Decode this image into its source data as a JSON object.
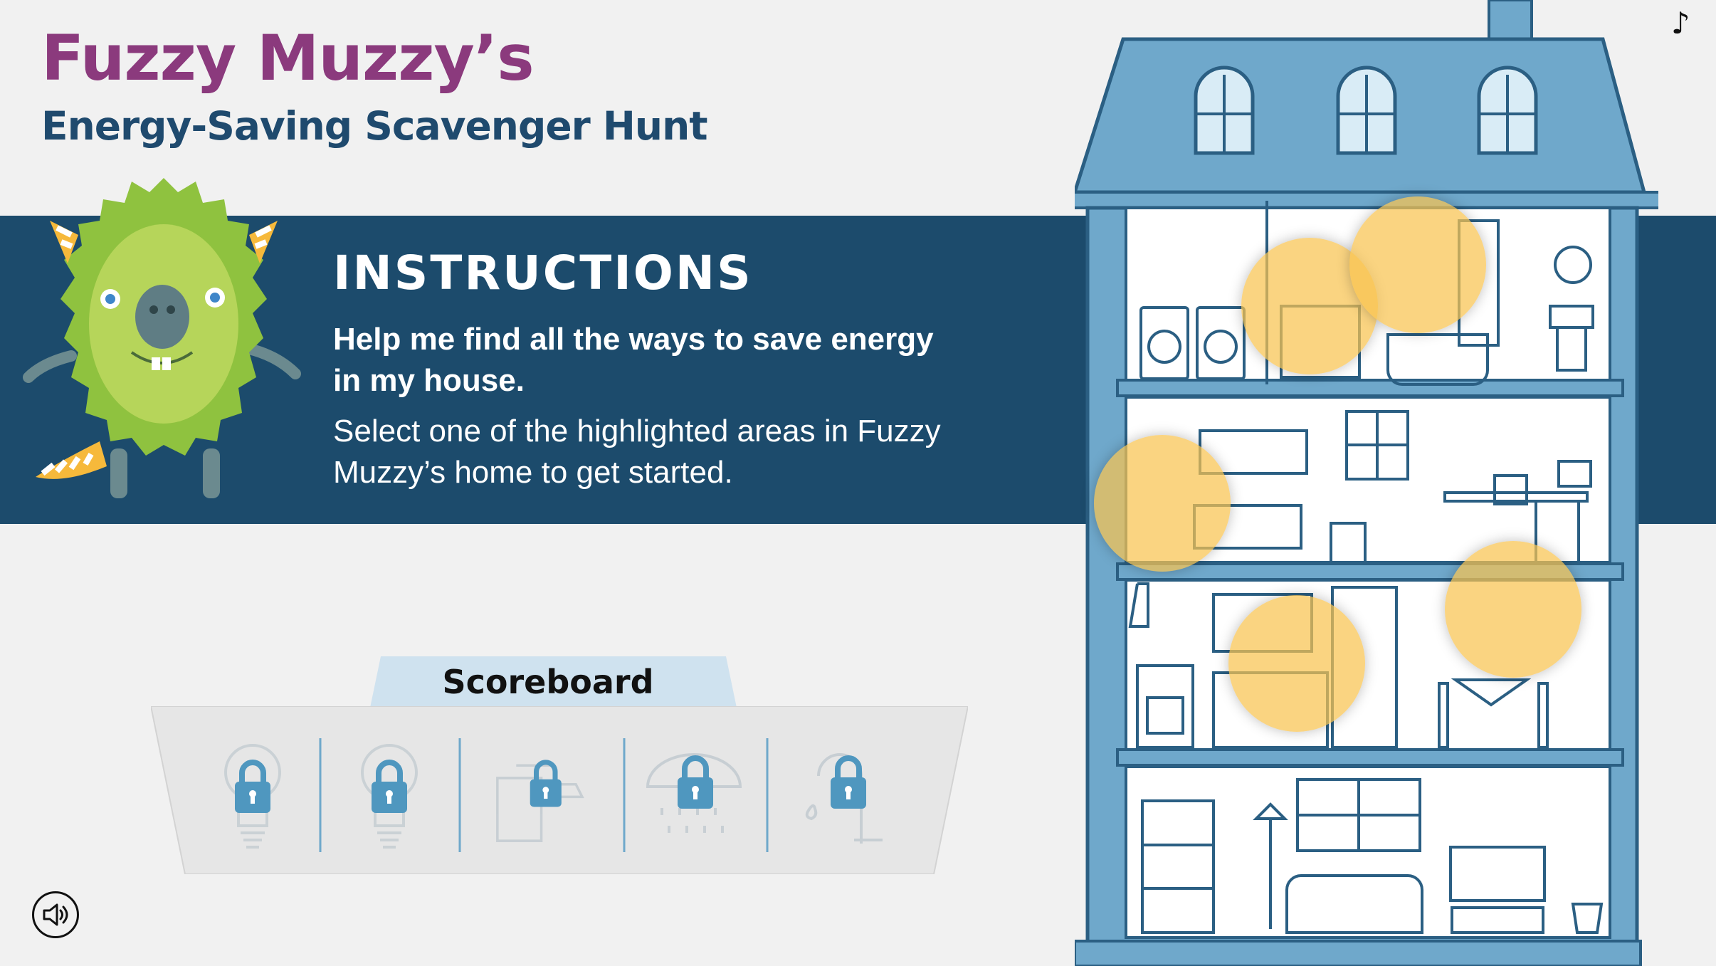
{
  "header": {
    "title": "Fuzzy Muzzy’s",
    "subtitle": "Energy-Saving Scavenger Hunt"
  },
  "instructions": {
    "heading": "INSTRUCTIONS",
    "bold_text": "Help me find all the ways to save energy in my house.",
    "body_text": "Select one of the highlighted areas in Fuzzy Muzzy’s home to get started."
  },
  "scoreboard": {
    "label": "Scoreboard",
    "items": [
      {
        "icon": "lightbulb-icon",
        "locked": true
      },
      {
        "icon": "lightbulb-icon",
        "locked": true
      },
      {
        "icon": "faucet-icon",
        "locked": true
      },
      {
        "icon": "shower-head-icon",
        "locked": true
      },
      {
        "icon": "sink-faucet-icon",
        "locked": true
      }
    ]
  },
  "controls": {
    "music_glyph": "♪",
    "sound_icon": "speaker-icon"
  },
  "hotspots": [
    {
      "name": "hotspot-bathroom-vanity"
    },
    {
      "name": "hotspot-bathroom-shower"
    },
    {
      "name": "hotspot-bedroom-lamp"
    },
    {
      "name": "hotspot-kitchen-sink"
    },
    {
      "name": "hotspot-dining-light"
    }
  ],
  "colors": {
    "title": "#8b3a7d",
    "subtitle": "#1f4a6e",
    "band": "#1c4b6c",
    "house_blue": "#6fa8cb",
    "hotspot": "#f8c350",
    "lock": "#4f97bf"
  }
}
